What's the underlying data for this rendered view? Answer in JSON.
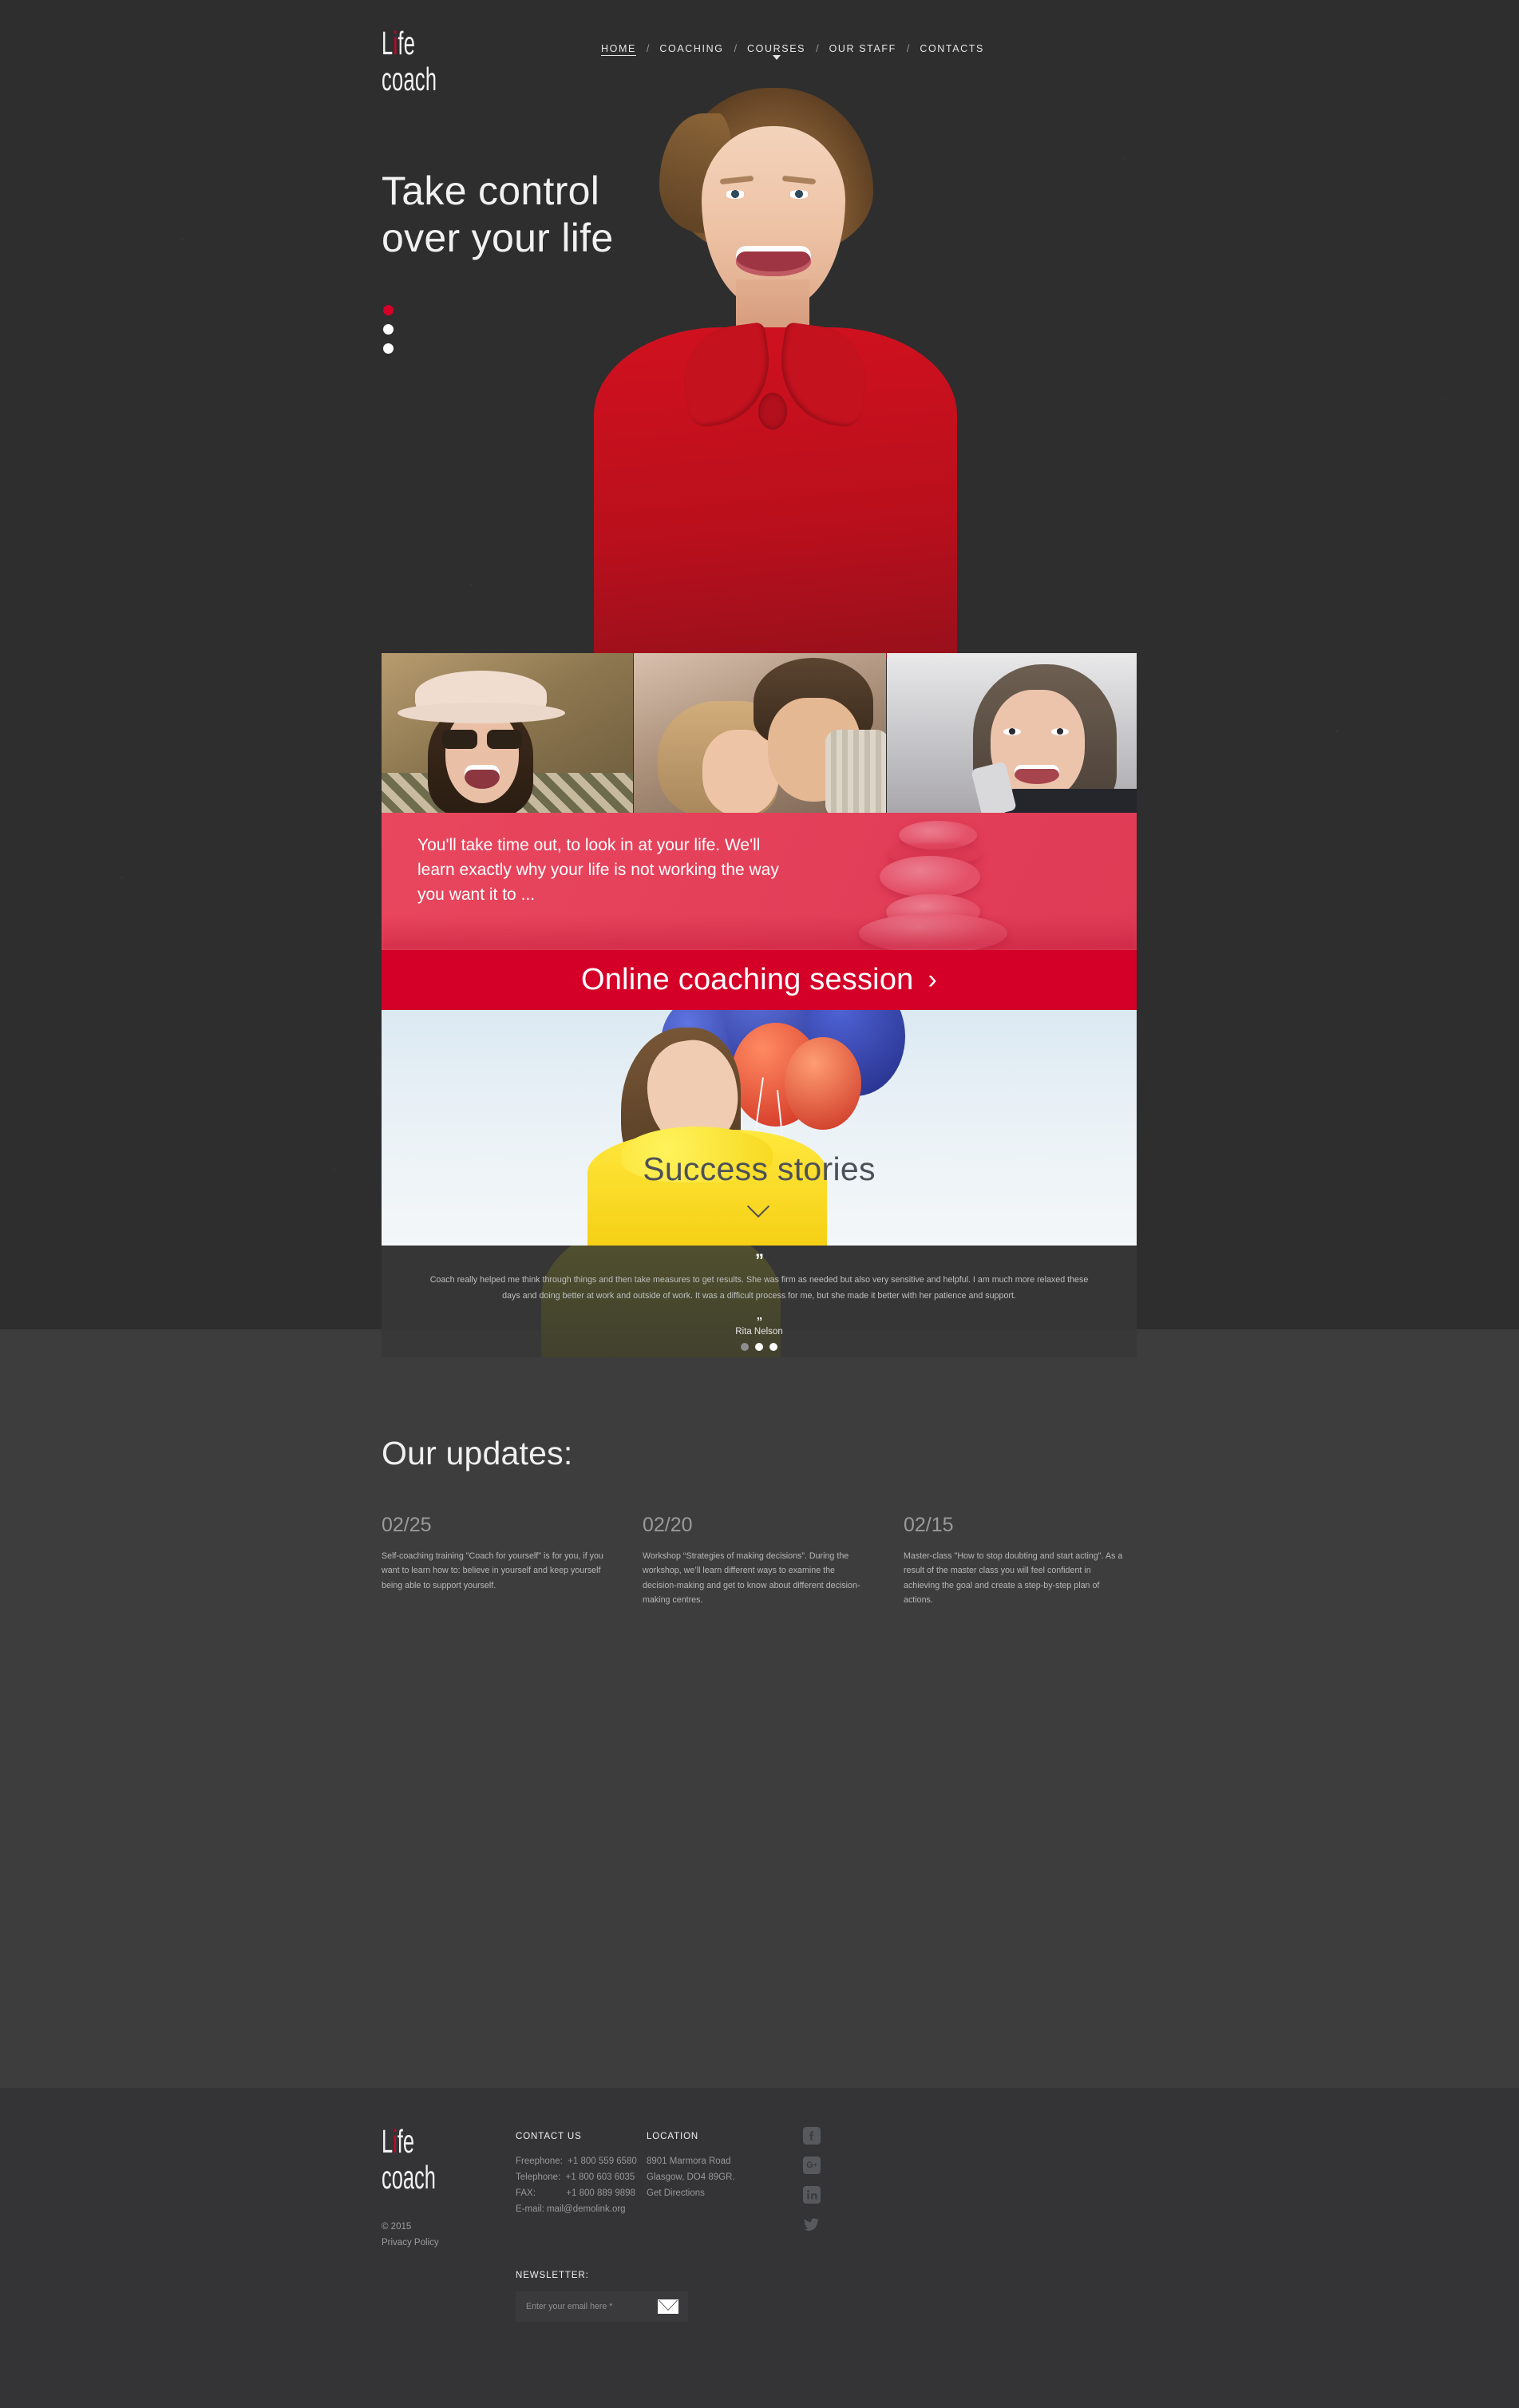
{
  "brand": {
    "line1_pre": "L",
    "line1_i": "i",
    "line1_post": "fe",
    "line2": "coach"
  },
  "nav": {
    "items": [
      {
        "label": "HOME",
        "active": true,
        "caret": false
      },
      {
        "label": "COACHING",
        "active": false,
        "caret": false
      },
      {
        "label": "COURSES",
        "active": false,
        "caret": true
      },
      {
        "label": "OUR STAFF",
        "active": false,
        "caret": false
      },
      {
        "label": "CONTACTS",
        "active": false,
        "caret": false
      }
    ],
    "separator": "/"
  },
  "hero": {
    "title_line1": "Take control",
    "title_line2": "over your life",
    "slider_dots": 3,
    "active_dot": 1
  },
  "promo": {
    "text": "You'll take time out, to look in at your life. We'll learn exactly why your life is not working the way you want it to ..."
  },
  "cta": {
    "label": "Online coaching session",
    "chevron": "›"
  },
  "stories": {
    "title": "Success stories",
    "arrow": "chevron-down-icon"
  },
  "testimonial": {
    "quote_open": "”",
    "quote_close": "”",
    "text": "Coach really helped me think through things and then take measures to get results.  She was firm as needed but also very sensitive and helpful.  I am much more relaxed these days and doing better at work and outside of work. It was a difficult process for me, but she made it better with her patience and support.",
    "author": "Rita Nelson",
    "dots": 3,
    "active_dot": 1
  },
  "updates": {
    "heading": "Our updates:",
    "items": [
      {
        "date": "02/25",
        "text": "Self-coaching training \"Coach for yourself\" is for you, if you want to learn how to: believe in yourself and keep yourself being able to support yourself."
      },
      {
        "date": "02/20",
        "text": "Workshop “Strategies of making decisions”. During the workshop, we’ll learn different ways to examine the decision-making and get to know about different decision-making centres."
      },
      {
        "date": "02/15",
        "text": "Master-class \"How to stop doubting and start acting\". As a result of the master class you will feel confident in achieving the goal and create a step-by-step plan of actions."
      }
    ]
  },
  "footer": {
    "copyright": "© 2015",
    "privacy": "Privacy Policy",
    "contact": {
      "heading": "CONTACT US",
      "lines": [
        "Freephone:  +1 800 559 6580",
        "Telephone:  +1 800 603 6035",
        "FAX:            +1 800 889 9898",
        "E-mail: mail@demolink.org"
      ]
    },
    "location": {
      "heading": "LOCATION",
      "lines": [
        "8901 Marmora Road",
        "Glasgow, DO4 89GR.",
        "Get Directions"
      ]
    },
    "social": [
      "facebook-icon",
      "google-plus-icon",
      "linkedin-icon",
      "twitter-icon"
    ],
    "newsletter": {
      "heading": "NEWSLETTER:",
      "placeholder": "Enter your email here *",
      "value": "",
      "submit_icon": "envelope-icon"
    }
  },
  "colors": {
    "accent_red": "#d40028",
    "rose": "#e8475e",
    "bg_dark": "#2e2e2e",
    "bg_mid": "#3d3d3e",
    "bg_footer": "#343436"
  }
}
